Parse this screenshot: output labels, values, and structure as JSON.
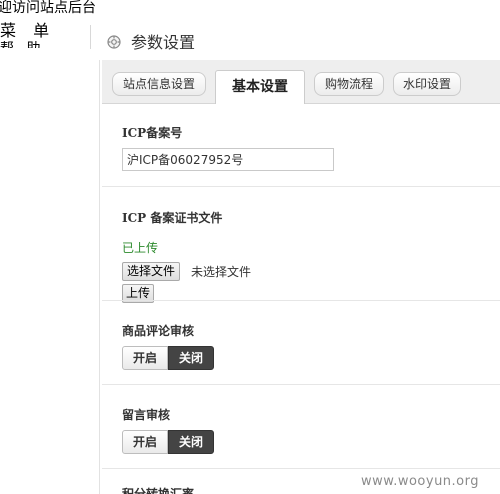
{
  "left_panel": {
    "welcome_text": "迎访问站点后台",
    "menu_label": "菜 单",
    "help_label": "帮 助"
  },
  "header": {
    "icon": "settings-gear-icon",
    "title": "参数设置"
  },
  "tabs": [
    {
      "label": "站点信息设置",
      "active": false
    },
    {
      "label": "基本设置",
      "active": true
    },
    {
      "label": "购物流程",
      "active": false
    },
    {
      "label": "水印设置",
      "active": false
    }
  ],
  "form": {
    "icp": {
      "label": "ICP备案号",
      "value": "沪ICP备06027952号"
    },
    "icp_cert": {
      "label": "ICP 备案证书文件",
      "status": "已上传",
      "choose_file_label": "选择文件",
      "no_file_label": "未选择文件",
      "upload_label": "上传"
    },
    "comment_review": {
      "label": "商品评论审核",
      "on_label": "开启",
      "off_label": "关闭",
      "selected": "关闭"
    },
    "message_review": {
      "label": "留言审核",
      "on_label": "开启",
      "off_label": "关闭",
      "selected": "关闭"
    },
    "next_label": "积分转换汇率"
  },
  "watermark": "www.wooyun.org",
  "colors": {
    "uploaded_status": "#2c8a2c",
    "toggle_off_bg": "#444444",
    "tabbar_bg": "#eeeeee"
  }
}
